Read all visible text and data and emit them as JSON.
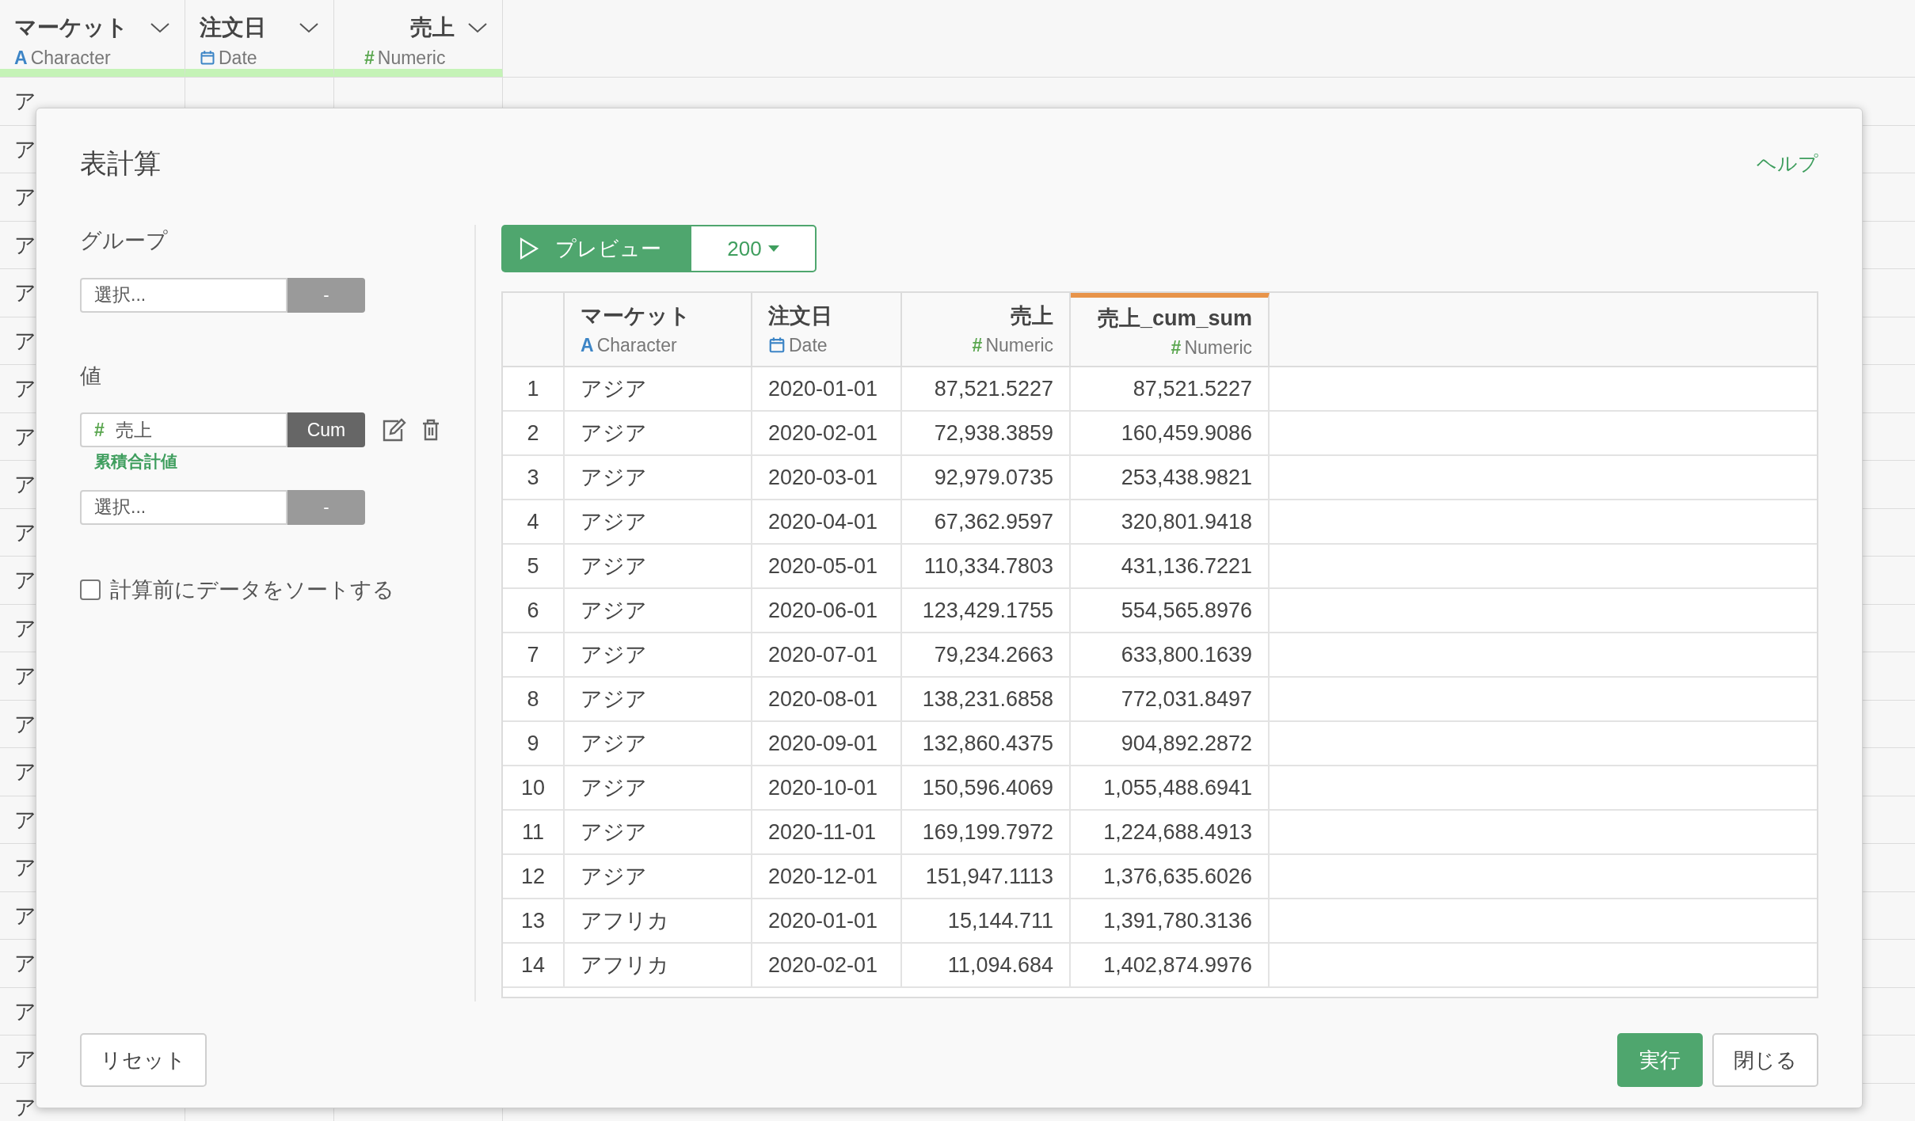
{
  "background_table": {
    "columns": [
      {
        "name": "マーケット",
        "kind": "character",
        "type": "Character",
        "type_mark": "A"
      },
      {
        "name": "注文日",
        "kind": "date",
        "type": "Date"
      },
      {
        "name": "売上",
        "kind": "numeric",
        "type": "Numeric",
        "type_mark": "#"
      }
    ],
    "cut_cells": [
      "ア",
      "ア",
      "ア",
      "ア",
      "ア",
      "ア",
      "ア",
      "ア",
      "ア",
      "ア",
      "ア",
      "ア",
      "ア",
      "ア",
      "ア",
      "ア",
      "ア",
      "ア",
      "ア",
      "ア",
      "ア",
      "ア"
    ]
  },
  "dialog": {
    "title": "表計算",
    "help_link": "ヘルプ",
    "group": {
      "label": "グループ",
      "placeholder": "選択...",
      "button": "-"
    },
    "values": {
      "label": "値",
      "items": [
        {
          "kind": "column",
          "type_mark": "#",
          "name": "売上",
          "function": "Cum",
          "caption": "累積合計値"
        },
        {
          "kind": "empty",
          "placeholder": "選択...",
          "button": "-"
        }
      ]
    },
    "sort_checkbox": {
      "label": "計算前にデータをソートする",
      "checked": false
    },
    "preview_button": "プレビュー",
    "row_limit": "200",
    "table": {
      "columns": [
        {
          "name": "マーケット",
          "kind": "character",
          "type": "Character",
          "type_mark": "A",
          "highlighted": false
        },
        {
          "name": "注文日",
          "kind": "date",
          "type": "Date",
          "highlighted": false
        },
        {
          "name": "売上",
          "kind": "numeric",
          "type": "Numeric",
          "type_mark": "#",
          "highlighted": false
        },
        {
          "name": "売上_cum_sum",
          "kind": "numeric",
          "type": "Numeric",
          "type_mark": "#",
          "highlighted": true
        }
      ],
      "rows": [
        {
          "index": "1",
          "cells": [
            "アジア",
            "2020-01-01",
            "87,521.5227",
            "87,521.5227"
          ]
        },
        {
          "index": "2",
          "cells": [
            "アジア",
            "2020-02-01",
            "72,938.3859",
            "160,459.9086"
          ]
        },
        {
          "index": "3",
          "cells": [
            "アジア",
            "2020-03-01",
            "92,979.0735",
            "253,438.9821"
          ]
        },
        {
          "index": "4",
          "cells": [
            "アジア",
            "2020-04-01",
            "67,362.9597",
            "320,801.9418"
          ]
        },
        {
          "index": "5",
          "cells": [
            "アジア",
            "2020-05-01",
            "110,334.7803",
            "431,136.7221"
          ]
        },
        {
          "index": "6",
          "cells": [
            "アジア",
            "2020-06-01",
            "123,429.1755",
            "554,565.8976"
          ]
        },
        {
          "index": "7",
          "cells": [
            "アジア",
            "2020-07-01",
            "79,234.2663",
            "633,800.1639"
          ]
        },
        {
          "index": "8",
          "cells": [
            "アジア",
            "2020-08-01",
            "138,231.6858",
            "772,031.8497"
          ]
        },
        {
          "index": "9",
          "cells": [
            "アジア",
            "2020-09-01",
            "132,860.4375",
            "904,892.2872"
          ]
        },
        {
          "index": "10",
          "cells": [
            "アジア",
            "2020-10-01",
            "150,596.4069",
            "1,055,488.6941"
          ]
        },
        {
          "index": "11",
          "cells": [
            "アジア",
            "2020-11-01",
            "169,199.7972",
            "1,224,688.4913"
          ]
        },
        {
          "index": "12",
          "cells": [
            "アジア",
            "2020-12-01",
            "151,947.1113",
            "1,376,635.6026"
          ]
        },
        {
          "index": "13",
          "cells": [
            "アフリカ",
            "2020-01-01",
            "15,144.711",
            "1,391,780.3136"
          ]
        },
        {
          "index": "14",
          "cells": [
            "アフリカ",
            "2020-02-01",
            "11,094.684",
            "1,402,874.9976"
          ]
        }
      ]
    },
    "buttons": {
      "reset": "リセット",
      "run": "実行",
      "close": "閉じる"
    }
  }
}
